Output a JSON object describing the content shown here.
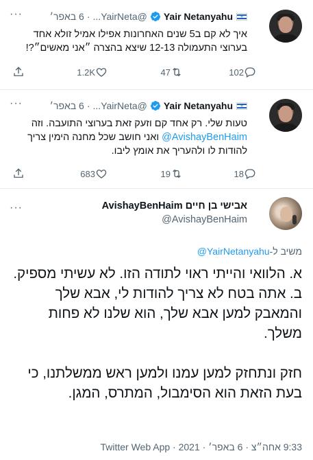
{
  "tweets": [
    {
      "name": "Yair Netanyahu",
      "handle": "@YairNeta...",
      "date": "6 באפר׳",
      "separator": "·",
      "text": "איך לא קם ב5 שנים האחרונות אפילו אמיל זולא אחד בערוצי התעמולה 12-13 שיצא בהצרה ״אני מאשים״?!",
      "replies": "102",
      "retweets": "47",
      "likes": "1.2K"
    },
    {
      "name": "Yair Netanyahu",
      "handle": "@YairNeta...",
      "date": "6 באפר׳",
      "separator": "·",
      "text_1": "טעות שלי. רק אחד קם וזעק זאת בערוצי התועבה. וזה",
      "mention": "@AvishayBenHaim",
      "text_2": "ואני חושב שכל מחנה הימין צריך",
      "text_3": "להודות לו ולהעריך את אומץ ליבו.",
      "replies": "18",
      "retweets": "19",
      "likes": "683"
    }
  ],
  "main_tweet": {
    "name": "אבישי בן חיים AvishayBenHaim",
    "handle": "@AvishayBenHaim",
    "replying_prefix": "משיב ל-",
    "replying_to": "@YairNetanyahu",
    "paragraph_1": "א. הלוואי והייתי ראוי לתודה הזו. לא עשיתי מספיק.",
    "paragraph_2": "ב. אתה בטח לא צריך להודות לי, אבא שלך והמאבק למען אבא שלך, הוא שלנו לא פחות משלך.",
    "paragraph_3": "חזק ונתחזק למען עמנו ולמען ראש ממשלתנו, כי בעת הזאת הוא הסימבול, המתרס, המגן.",
    "footer": "9:33 אחה״צ · 6 באפר׳ · 2021 · Twitter Web App"
  },
  "icons": [
    "reply-icon",
    "retweet-icon",
    "like-icon",
    "share-icon",
    "verified-badge-icon",
    "israel-flag-icon",
    "more-icon"
  ],
  "colors": {
    "accent": "#1d9bf0",
    "secondary_text": "#536471",
    "divider": "#e6ecf0"
  }
}
